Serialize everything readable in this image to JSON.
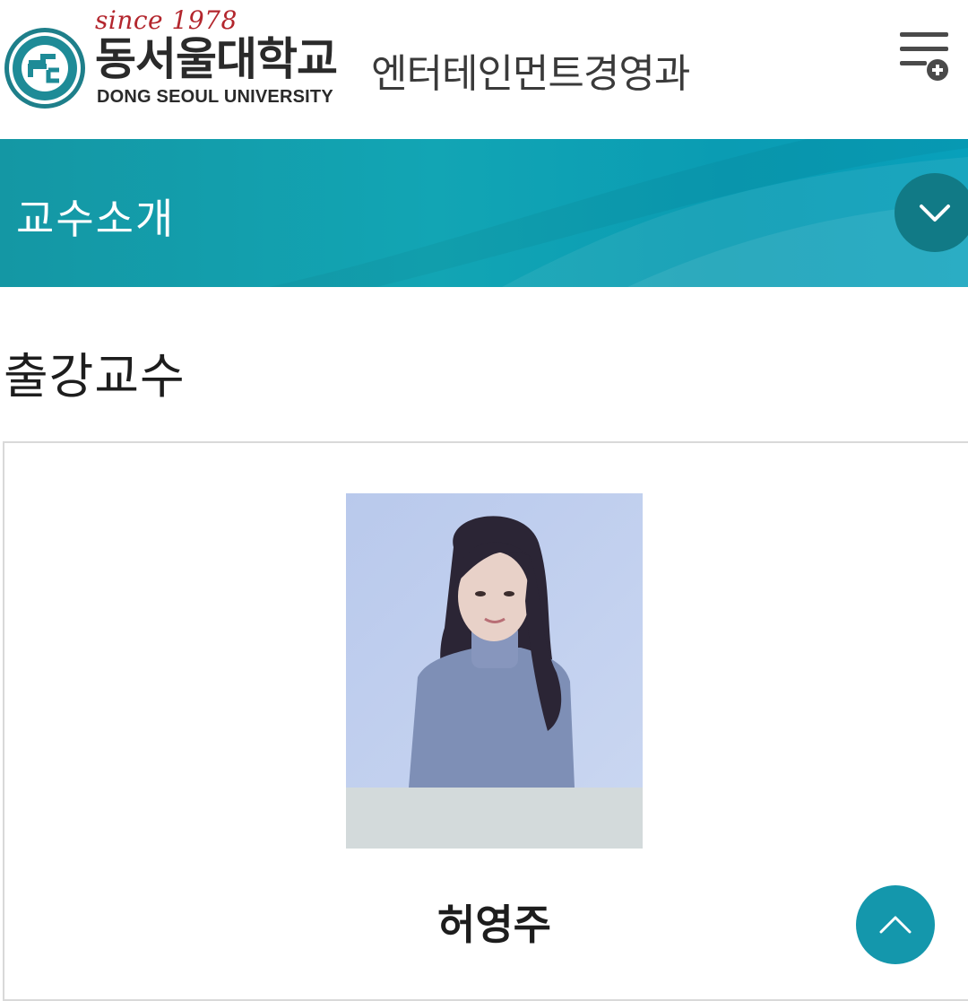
{
  "header": {
    "since": "since 1978",
    "university_kr": "동서울대학교",
    "university_en": "DONG SEOUL UNIVERSITY",
    "department": "엔터테인먼트경영과",
    "menu_icon": "menu-plus-icon"
  },
  "banner": {
    "title": "교수소개",
    "toggle_icon": "chevron-down-icon"
  },
  "section": {
    "title": "출강교수"
  },
  "professor": {
    "name": "허영주",
    "photo_icon": "portrait-photo"
  },
  "scroll_top_icon": "chevron-up-icon",
  "colors": {
    "accent": "#1497ac",
    "banner": "#12a5b4",
    "text": "#1d1d1d",
    "since": "#b3262d"
  }
}
